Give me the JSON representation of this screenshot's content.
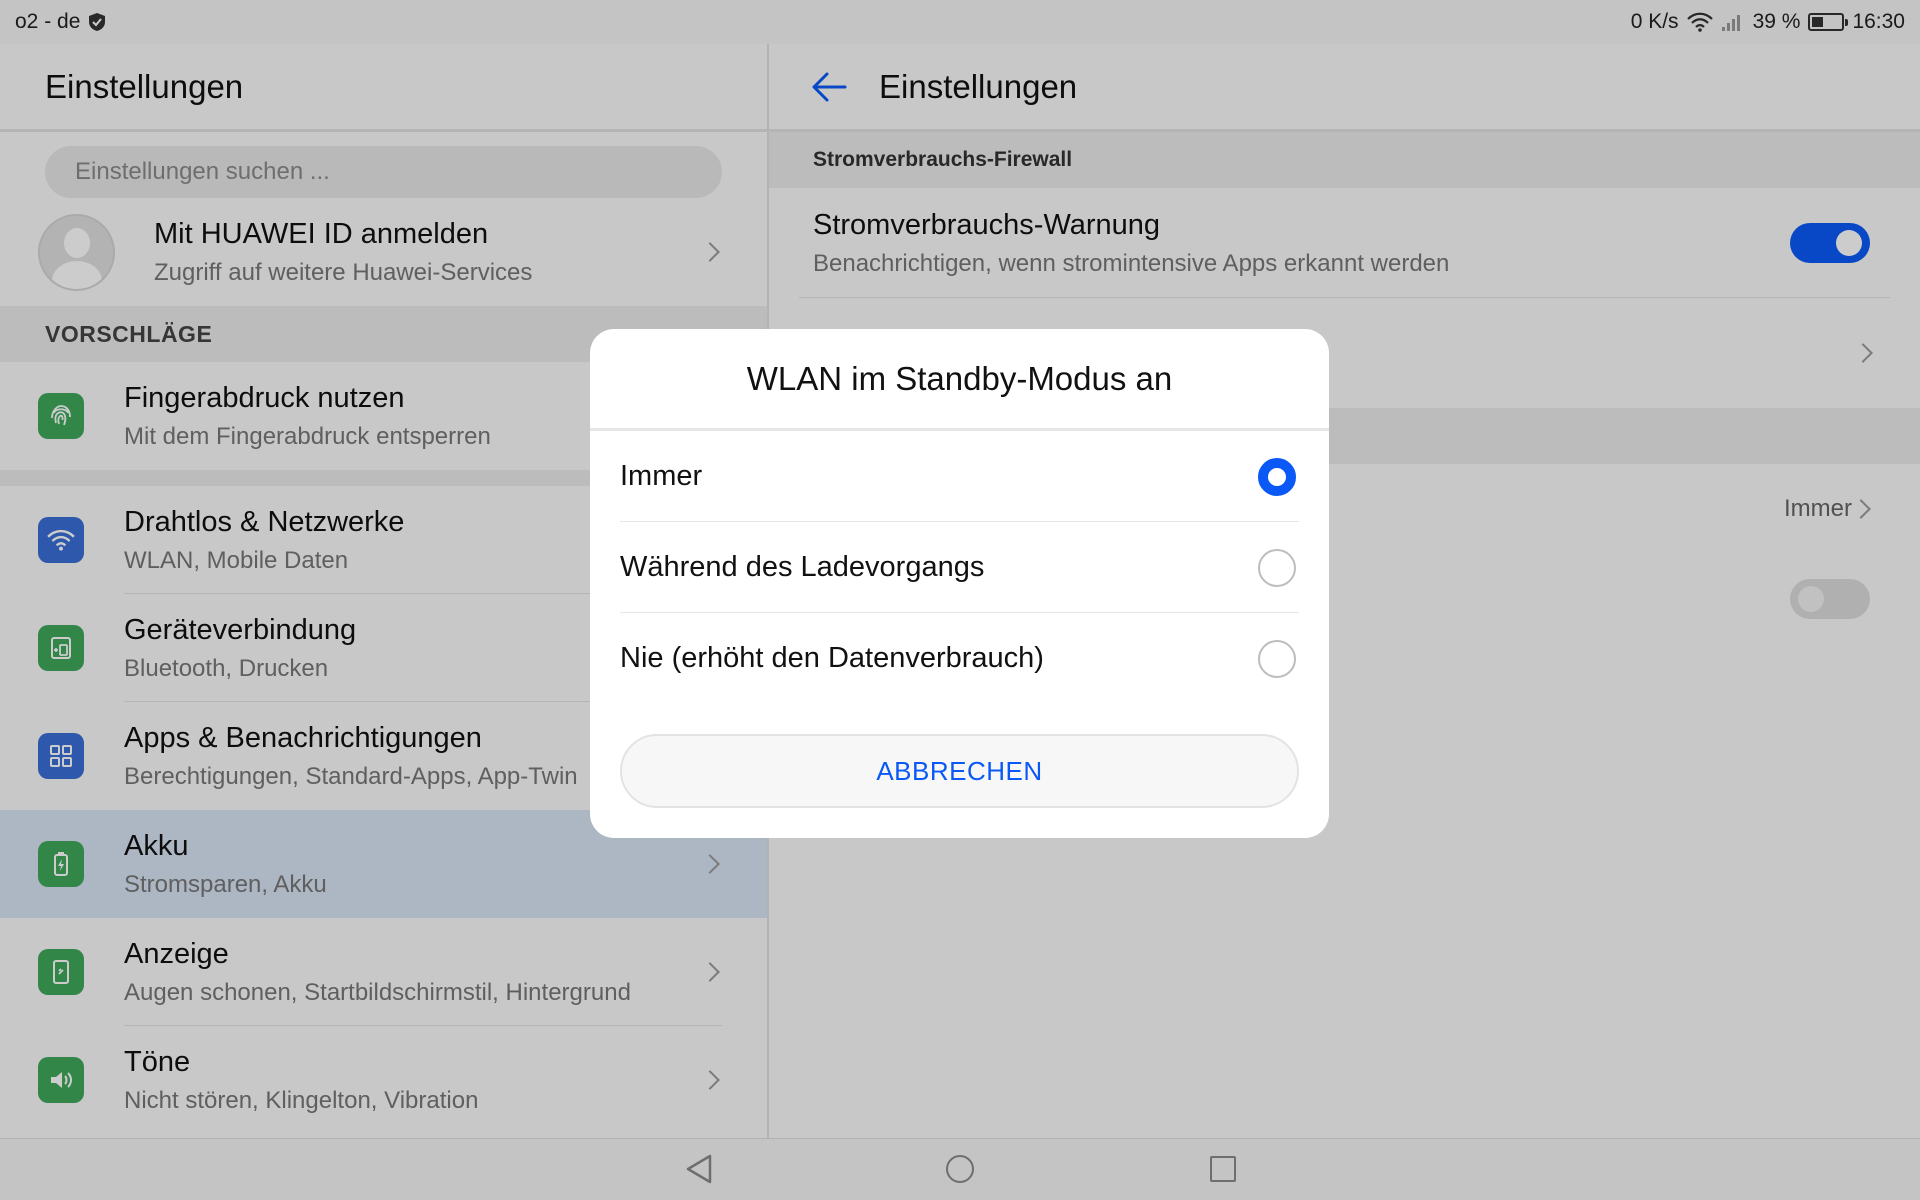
{
  "statusbar": {
    "carrier": "o2 - de",
    "speed": "0 K/s",
    "battery": "39 %",
    "battery_level": 0.39,
    "time": "16:30"
  },
  "left": {
    "title": "Einstellungen",
    "search_placeholder": "Einstellungen suchen ...",
    "profile": {
      "title": "Mit HUAWEI ID anmelden",
      "subtitle": "Zugriff auf weitere Huawei-Services"
    },
    "suggestions_header": "VORSCHLÄGE",
    "suggestion": {
      "title": "Fingerabdruck nutzen",
      "subtitle": "Mit dem Fingerabdruck entsperren",
      "color": "#3fa85b"
    },
    "items": [
      {
        "title": "Drahtlos & Netzwerke",
        "subtitle": "WLAN, Mobile Daten",
        "color": "#3a6fd8"
      },
      {
        "title": "Geräteverbindung",
        "subtitle": "Bluetooth, Drucken",
        "color": "#3fa85b"
      },
      {
        "title": "Apps & Benachrichtigungen",
        "subtitle": "Berechtigungen, Standard-Apps, App-Twin",
        "color": "#3a6fd8"
      },
      {
        "title": "Akku",
        "subtitle": "Stromsparen, Akku",
        "color": "#3fa85b"
      },
      {
        "title": "Anzeige",
        "subtitle": "Augen schonen, Startbildschirmstil, Hintergrund",
        "color": "#3fa85b"
      },
      {
        "title": "Töne",
        "subtitle": "Nicht stören, Klingelton, Vibration",
        "color": "#3fa85b"
      }
    ]
  },
  "right": {
    "title": "Einstellungen",
    "section": "Stromverbrauchs-Firewall",
    "warning": {
      "title": "Stromverbrauchs-Warnung",
      "subtitle": "Benachrichtigen, wenn stromintensive Apps erkannt werden"
    },
    "standby_value": "Immer"
  },
  "dialog": {
    "title": "WLAN im Standby-Modus an",
    "options": [
      "Immer",
      "Während des Ladevorgangs",
      "Nie (erhöht den Datenverbrauch)"
    ],
    "selected_index": 0,
    "cancel_label": "ABBRECHEN"
  },
  "colors": {
    "accent": "#0a59f7",
    "selected_row": "#d9e4f4"
  }
}
